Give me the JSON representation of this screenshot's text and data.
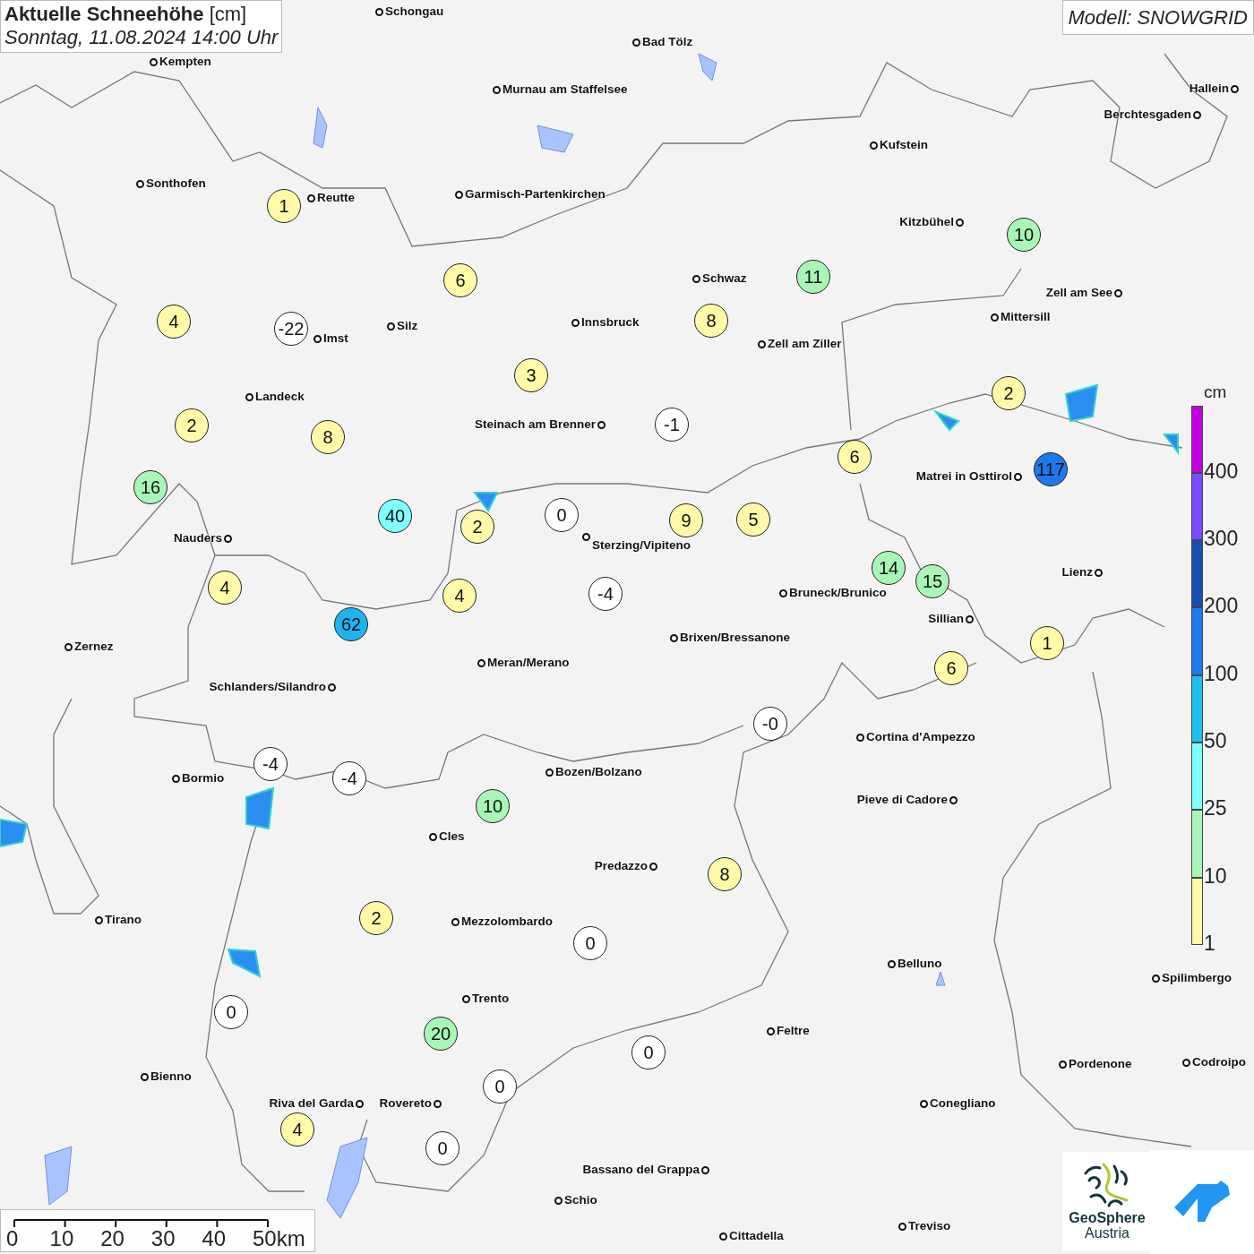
{
  "title": {
    "heading": "**Aktuelle Schneehöhe** [cm]",
    "timestamp": "Sonntag, 11.08.2024 14:00 Uhr"
  },
  "model": "Modell: SNOWGRID",
  "cities": [
    "Schongau",
    "Bad Tölz",
    "Kempten",
    "Murnau am Staffelsee",
    "Hallein",
    "Berchtesgaden",
    "Kufstein",
    "Sonthofen",
    "Reutte",
    "Garmisch-Partenkirchen",
    "Kitzbühel",
    "Schwaz",
    "Zell am See",
    "Mittersill",
    "Silz",
    "Innsbruck",
    "Imst",
    "Zell am Ziller",
    "Landeck",
    "Steinach am Brenner",
    "Matrei in Osttirol",
    "Nauders",
    "Sterzing/Vipiteno",
    "Lienz",
    "Bruneck/Brunico",
    "Sillian",
    "Brixen/Bressanone",
    "Zernez",
    "Meran/Merano",
    "Schlanders/Silandro",
    "Cortina d'Ampezzo",
    "Bozen/Bolzano",
    "Bormio",
    "Pieve di Cadore",
    "Cles",
    "Predazzo",
    "Tirano",
    "Mezzolombardo",
    "Belluno",
    "Spilimbergo",
    "Trento",
    "Feltre",
    "Pordenone",
    "Codroipo",
    "Bienno",
    "Riva del Garda",
    "Rovereto",
    "Conegliano",
    "Bassano del Grappa",
    "Schio",
    "Treviso",
    "Cittadella"
  ],
  "stations": [
    {
      "value": "1",
      "color": "#fff9a8"
    },
    {
      "value": "6",
      "color": "#fff9a8"
    },
    {
      "value": "4",
      "color": "#fff9a8"
    },
    {
      "value": "-22",
      "color": "#ffffff"
    },
    {
      "value": "11",
      "color": "#a9f5b5"
    },
    {
      "value": "10",
      "color": "#a9f5b5"
    },
    {
      "value": "8",
      "color": "#fff9a8"
    },
    {
      "value": "3",
      "color": "#fff9a8"
    },
    {
      "value": "2",
      "color": "#fff9a8"
    },
    {
      "value": "8",
      "color": "#fff9a8"
    },
    {
      "value": "-1",
      "color": "#ffffff"
    },
    {
      "value": "2",
      "color": "#fff9a8"
    },
    {
      "value": "6",
      "color": "#fff9a8"
    },
    {
      "value": "117",
      "color": "#1e78f0"
    },
    {
      "value": "16",
      "color": "#a9f5b5"
    },
    {
      "value": "40",
      "color": "#80ffff"
    },
    {
      "value": "2",
      "color": "#fff9a8"
    },
    {
      "value": "0",
      "color": "#ffffff"
    },
    {
      "value": "9",
      "color": "#fff9a8"
    },
    {
      "value": "5",
      "color": "#fff9a8"
    },
    {
      "value": "4",
      "color": "#fff9a8"
    },
    {
      "value": "62",
      "color": "#1eb4f0"
    },
    {
      "value": "4",
      "color": "#fff9a8"
    },
    {
      "value": "-4",
      "color": "#ffffff"
    },
    {
      "value": "14",
      "color": "#a9f5b5"
    },
    {
      "value": "15",
      "color": "#a9f5b5"
    },
    {
      "value": "1",
      "color": "#fff9a8"
    },
    {
      "value": "6",
      "color": "#fff9a8"
    },
    {
      "value": "-0",
      "color": "#ffffff"
    },
    {
      "value": "-4",
      "color": "#ffffff"
    },
    {
      "value": "-4",
      "color": "#ffffff"
    },
    {
      "value": "10",
      "color": "#a9f5b5"
    },
    {
      "value": "8",
      "color": "#fff9a8"
    },
    {
      "value": "2",
      "color": "#fff9a8"
    },
    {
      "value": "0",
      "color": "#ffffff"
    },
    {
      "value": "0",
      "color": "#ffffff"
    },
    {
      "value": "20",
      "color": "#a9f5b5"
    },
    {
      "value": "0",
      "color": "#ffffff"
    },
    {
      "value": "0",
      "color": "#ffffff"
    },
    {
      "value": "4",
      "color": "#fff9a8"
    },
    {
      "value": "0",
      "color": "#ffffff"
    }
  ],
  "legend": {
    "unit": "cm",
    "steps": [
      {
        "label": "400",
        "color": "#c000e0"
      },
      {
        "label": "300",
        "color": "#7a4cff"
      },
      {
        "label": "200",
        "color": "#1450b4"
      },
      {
        "label": "100",
        "color": "#1e7af0"
      },
      {
        "label": "50",
        "color": "#1ec0f0"
      },
      {
        "label": "25",
        "color": "#80ffff"
      },
      {
        "label": "10",
        "color": "#a8f5b8"
      },
      {
        "label": "1",
        "color": "#fff8a8"
      }
    ]
  },
  "scale": [
    "0",
    "10",
    "20",
    "30",
    "40",
    "50km"
  ],
  "logo": {
    "name": "GeoSphere",
    "sub": "Austria"
  }
}
